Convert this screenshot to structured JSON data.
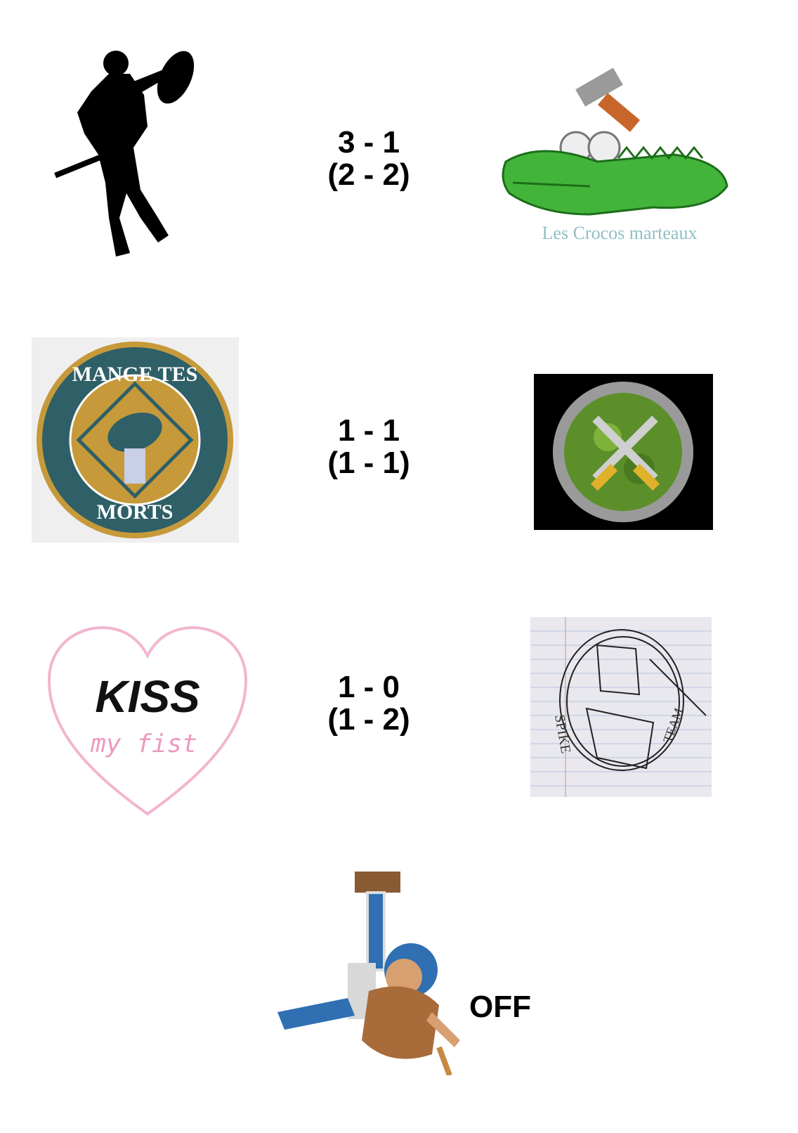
{
  "matches": [
    {
      "score": "3 - 1",
      "secondary": "(2 - 2)"
    },
    {
      "score": "1 - 1",
      "secondary": "(1 - 1)"
    },
    {
      "score": "1 - 0",
      "secondary": "(1 - 2)"
    }
  ],
  "logos": {
    "crocos_caption": "Les Crocos marteaux",
    "mange_top": "MANGE TES",
    "mange_bottom": "MORTS",
    "kiss_word": "KISS",
    "kiss_sub": "my fist",
    "sketch_word_left": "SPIKE",
    "sketch_word_right": "TEAM"
  },
  "bye_label": "OFF",
  "icons": [
    "warrior-silhouette-icon",
    "crocodile-hammer-icon",
    "team-crest-icon",
    "crossed-fork-knife-icon",
    "heart-icon",
    "sketch-shield-icon",
    "fallen-player-icon"
  ]
}
